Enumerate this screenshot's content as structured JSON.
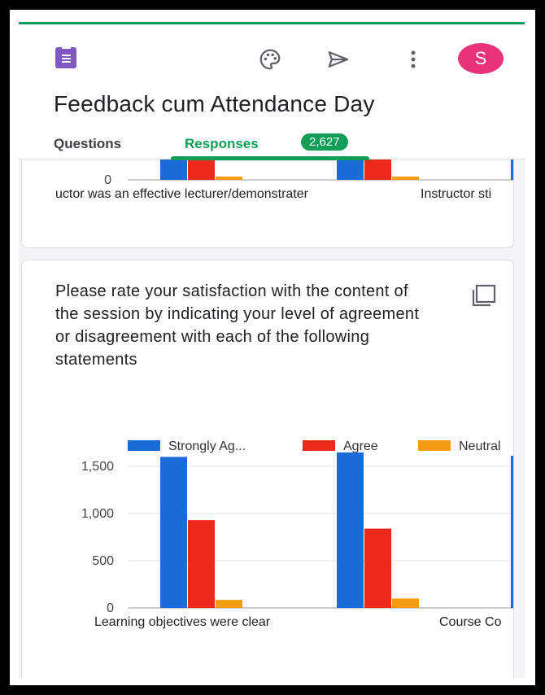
{
  "app": {
    "form_title": "Feedback cum Attendance Day",
    "avatar_letter": "S",
    "icons": [
      "forms-logo-icon",
      "palette-icon",
      "send-icon",
      "more-vert-icon",
      "copy-icon"
    ],
    "accent_color": "#0f9d58",
    "avatar_color": "#e8327a"
  },
  "tabs": {
    "questions": "Questions",
    "responses": "Responses",
    "responses_count": "2,627"
  },
  "top_chart": {
    "zero_label": "0",
    "categories": [
      "uctor was an effective lecturer/demonstrater",
      "Instructor sti"
    ]
  },
  "question": {
    "text": "Please rate your satisfaction with the content of the session by indicating your level of agreement or disagreement with each of the following statements"
  },
  "chart_data": {
    "type": "bar",
    "categories": [
      "Learning objectives were clear",
      "Course Co"
    ],
    "series": [
      {
        "name": "Strongly Ag...",
        "color": "#1a6bd8",
        "values": [
          1600,
          1670
        ]
      },
      {
        "name": "Agree",
        "color": "#ea2a1b",
        "values": [
          930,
          840
        ]
      },
      {
        "name": "Neutral",
        "color": "#f59c12",
        "values": [
          85,
          100
        ]
      }
    ],
    "y_ticks": [
      "0",
      "500",
      "1,000",
      "1,500"
    ],
    "ylim": [
      0,
      1500
    ],
    "legend_position": "top",
    "grid": true
  }
}
